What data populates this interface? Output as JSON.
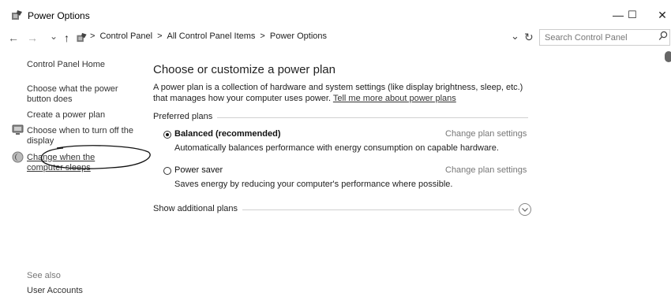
{
  "window": {
    "title": "Power Options",
    "minimize_glyph": "—",
    "maximize_glyph": "☐",
    "close_glyph": "✕"
  },
  "nav": {
    "back_glyph": "←",
    "forward_glyph": "→",
    "recent_glyph": "⌄",
    "up_glyph": "↑",
    "breadcrumbs": [
      "Control Panel",
      "All Control Panel Items",
      "Power Options"
    ],
    "separator": ">",
    "dropdown_glyph": "⌄",
    "refresh_glyph": "↻",
    "search_placeholder": "Search Control Panel"
  },
  "sidebar": {
    "home": "Control Panel Home",
    "links": [
      "Choose what the power button does",
      "Create a power plan",
      "Choose when to turn off the display",
      "Change when the computer sleeps"
    ],
    "see_also_label": "See also",
    "see_also_links": [
      "User Accounts"
    ]
  },
  "main": {
    "heading": "Choose or customize a power plan",
    "description": "A power plan is a collection of hardware and system settings (like display brightness, sleep, etc.) that manages how your computer uses power.",
    "learn_more": "Tell me more about power plans",
    "preferred_label": "Preferred plans",
    "plans": [
      {
        "name": "Balanced (recommended)",
        "selected": true,
        "description": "Automatically balances performance with energy consumption on capable hardware.",
        "change": "Change plan settings"
      },
      {
        "name": "Power saver",
        "selected": false,
        "description": "Saves energy by reducing your computer's performance where possible.",
        "change": "Change plan settings"
      }
    ],
    "additional_label": "Show additional plans"
  },
  "icons": {
    "title": "power-options-icon",
    "up": "up-arrow-icon",
    "crumb": "control-panel-icon",
    "display": "display-icon",
    "sleep": "sleep-moon-icon",
    "search": "search-icon",
    "expand": "chevron-circle-down-icon"
  }
}
